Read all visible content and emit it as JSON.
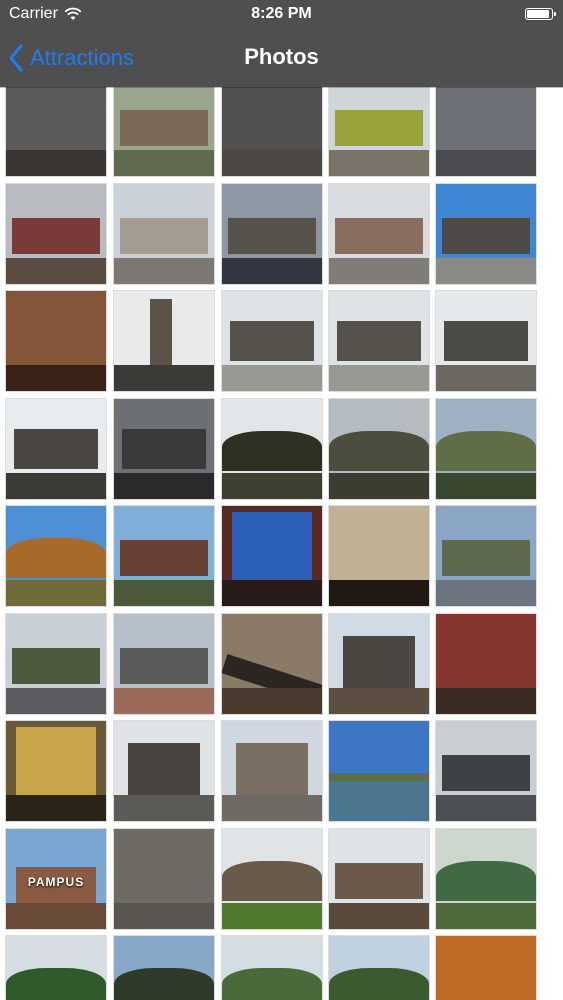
{
  "status_bar": {
    "carrier": "Carrier",
    "time": "8:26 PM",
    "wifi_icon": "wifi-icon",
    "battery_icon": "battery-icon",
    "battery_level": 1.0
  },
  "nav": {
    "back_label": "Attractions",
    "back_icon": "chevron-left-icon",
    "title": "Photos"
  },
  "colors": {
    "header_bg": "#4f4f4f",
    "accent": "#1f7bf2",
    "title_text": "#ffffff"
  },
  "photos": [
    {
      "sky": "#b9c3cc",
      "ground": "#3a3633",
      "mass": "#4b4845",
      "style": "facade"
    },
    {
      "sky": "#9aa58e",
      "ground": "#5f6b4c",
      "mass": "#7b6a56",
      "style": "canal"
    },
    {
      "sky": "#c8cdd3",
      "ground": "#4a4744",
      "mass": "#3b3a39",
      "style": "facade"
    },
    {
      "sky": "#cfd5d8",
      "ground": "#7a7468",
      "mass": "#9aa13a",
      "style": "street"
    },
    {
      "sky": "#d7dce0",
      "ground": "#4a4c50",
      "mass": "#5a5d63",
      "style": "facade"
    },
    {
      "sky": "#b8bcc1",
      "ground": "#5a4a42",
      "mass": "#7a3a3a",
      "style": "street"
    },
    {
      "sky": "#c9d0d6",
      "ground": "#7b7872",
      "mass": "#a39c92",
      "style": "square"
    },
    {
      "sky": "#8d98a4",
      "ground": "#30373f",
      "mass": "#57524a",
      "style": "canal"
    },
    {
      "sky": "#d9dde0",
      "ground": "#807d77",
      "mass": "#8b6f5e",
      "style": "street"
    },
    {
      "sky": "#3f86d4",
      "ground": "#8a8a86",
      "mass": "#4e4a48",
      "style": "square"
    },
    {
      "sky": "#5a3a2a",
      "ground": "#3a2218",
      "mass": "#8b5a3c",
      "style": "interior"
    },
    {
      "sky": "#e8eaec",
      "ground": "#3b3a36",
      "mass": "#5b5248",
      "style": "tower"
    },
    {
      "sky": "#dfe3e6",
      "ground": "#9a9893",
      "mass": "#55524c",
      "style": "palace"
    },
    {
      "sky": "#dfe3e6",
      "ground": "#9a9893",
      "mass": "#55524c",
      "style": "palace"
    },
    {
      "sky": "#e6e9ec",
      "ground": "#6b6862",
      "mass": "#4c4a46",
      "style": "palace"
    },
    {
      "sky": "#e9ecee",
      "ground": "#3c3a37",
      "mass": "#4a4743",
      "style": "palace"
    },
    {
      "sky": "#6c7074",
      "ground": "#2a2a2a",
      "mass": "#3a3a3a",
      "style": "palace"
    },
    {
      "sky": "#e3e6e8",
      "ground": "#3b4030",
      "mass": "#2c3124",
      "style": "park"
    },
    {
      "sky": "#b4bcc2",
      "ground": "#3a3d30",
      "mass": "#4b4e3e",
      "style": "park"
    },
    {
      "sky": "#9fb2c4",
      "ground": "#39472f",
      "mass": "#5f6e46",
      "style": "park"
    },
    {
      "sky": "#4d8fd2",
      "ground": "#6f6b3a",
      "mass": "#a86a2b",
      "style": "park"
    },
    {
      "sky": "#7fb0d9",
      "ground": "#4b5a3a",
      "mass": "#6a4034",
      "style": "street"
    },
    {
      "sky": "#5a2a22",
      "ground": "#2a1a18",
      "mass": "#2c60b8",
      "style": "window"
    },
    {
      "sky": "#3a2a22",
      "ground": "#221812",
      "mass": "#d8c8a8",
      "style": "interior"
    },
    {
      "sky": "#8aa6c4",
      "ground": "#6b7480",
      "mass": "#5d6a4f",
      "style": "canal"
    },
    {
      "sky": "#c7d0d7",
      "ground": "#5a5c60",
      "mass": "#4e5a3e",
      "style": "canal"
    },
    {
      "sky": "#b5bfca",
      "ground": "#9b6a5a",
      "mass": "#5a5b58",
      "style": "street"
    },
    {
      "sky": "#8a7a66",
      "ground": "#4a3a2e",
      "mass": "#2a2622",
      "style": "bridge"
    },
    {
      "sky": "#d0dbe6",
      "ground": "#5c4e40",
      "mass": "#4a4640",
      "style": "church"
    },
    {
      "sky": "#c9b58a",
      "ground": "#3a2c24",
      "mass": "#7a1e1e",
      "style": "interior"
    },
    {
      "sky": "#6a5a3a",
      "ground": "#2a2418",
      "mass": "#c9a44a",
      "style": "window"
    },
    {
      "sky": "#dfe3e6",
      "ground": "#5c5a56",
      "mass": "#4a4440",
      "style": "church"
    },
    {
      "sky": "#cfd8e0",
      "ground": "#6e6a62",
      "mass": "#7a6e62",
      "style": "church"
    },
    {
      "sky": "#3d77c4",
      "ground": "#4a7690",
      "mass": "#5e6c50",
      "style": "water"
    },
    {
      "sky": "#c9ced2",
      "ground": "#4b4e52",
      "mass": "#3e4146",
      "style": "square"
    },
    {
      "sky": "#7aa6d2",
      "ground": "#6b4c3a",
      "mass": "#8a5a42",
      "style": "pampus",
      "text": "PAMPUS"
    },
    {
      "sky": "#7a7670",
      "ground": "#5a5650",
      "mass": "#6c6862",
      "style": "wall"
    },
    {
      "sky": "#e0e4e6",
      "ground": "#4f7a2e",
      "mass": "#6a5a4a",
      "style": "park"
    },
    {
      "sky": "#dfe3e6",
      "ground": "#5a4a3c",
      "mass": "#6b5a4a",
      "style": "street"
    },
    {
      "sky": "#cdd6cf",
      "ground": "#4f6a3a",
      "mass": "#3f6a44",
      "style": "park"
    },
    {
      "sky": "#d6dee4",
      "ground": "#3c6a2a",
      "mass": "#2f5a2c",
      "style": "park"
    },
    {
      "sky": "#88a8c8",
      "ground": "#3a4a3a",
      "mass": "#2e3a2a",
      "style": "park"
    },
    {
      "sky": "#d4dde4",
      "ground": "#5a6a3e",
      "mass": "#4a6a3a",
      "style": "park"
    },
    {
      "sky": "#c0d2e0",
      "ground": "#3c6a58",
      "mass": "#3a5a30",
      "style": "park"
    },
    {
      "sky": "#2a1a1a",
      "ground": "#6a2a1a",
      "mass": "#d87a2a",
      "style": "interior"
    }
  ]
}
